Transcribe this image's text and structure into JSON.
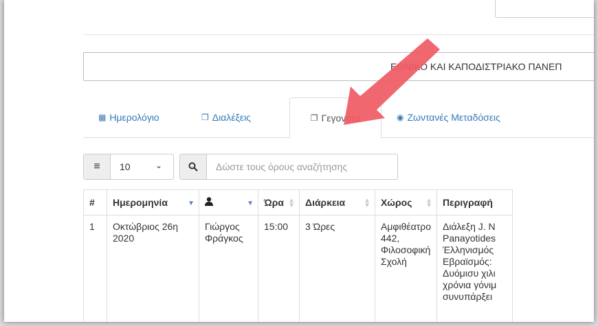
{
  "banner": {
    "text": "ΕΘΝΙΚΟ ΚΑΙ ΚΑΠΟΔΙΣΤΡΙΑΚΟ ΠΑΝΕΠ"
  },
  "tabs": [
    {
      "label": "Ημερολόγιο",
      "icon": "calendar-icon",
      "glyph": "▦"
    },
    {
      "label": "Διαλέξεις",
      "icon": "book-icon",
      "glyph": "❐"
    },
    {
      "label": "Γεγονότα",
      "icon": "event-icon",
      "glyph": "❐"
    },
    {
      "label": "Ζωντανές Μεταδόσεις",
      "icon": "broadcast-icon",
      "glyph": "◉"
    }
  ],
  "toolbar": {
    "page_size": "10",
    "search_placeholder": "Δώστε τους όρους αναζήτησης"
  },
  "table": {
    "headers": [
      "#",
      "Ημερομηνία",
      "",
      "Ώρα",
      "Διάρκεια",
      "Χώρος",
      "Περιγραφή"
    ],
    "rows": [
      {
        "num": "1",
        "date": "Οκτώβριος 26η 2020",
        "person": "Γιώργος Φράγκος",
        "time": "15:00",
        "duration": "3 Ώρες",
        "place": "Αμφιθέατρο 442, Φιλοσοφική Σχολή",
        "description": "Διάλεξη J. N Panayotides Έλληνισμός Εβραϊσμός: Δυόμισυ χιλι χρόνια γόνιμ συνυπάρξει"
      }
    ]
  },
  "colors": {
    "link": "#337ab7",
    "sort_active": "#5a7fd0",
    "arrow": "#f05a64"
  }
}
